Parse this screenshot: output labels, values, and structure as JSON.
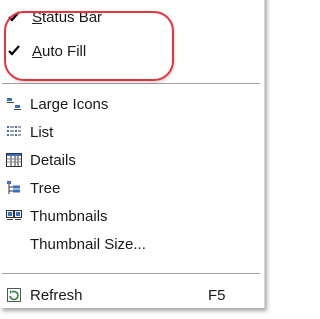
{
  "menu": {
    "items": [
      {
        "label_pre": "",
        "label_u": "S",
        "label_post": "tatus Bar",
        "checked": true
      },
      {
        "label_pre": "",
        "label_u": "A",
        "label_post": "uto Fill",
        "checked": true
      },
      {
        "label": "Large Icons",
        "icon": "large-icons-icon"
      },
      {
        "label": "List",
        "icon": "list-icon"
      },
      {
        "label": "Details",
        "icon": "details-icon"
      },
      {
        "label": "Tree",
        "icon": "tree-icon"
      },
      {
        "label": "Thumbnails",
        "icon": "thumbnails-icon"
      },
      {
        "label": "Thumbnail Size...",
        "icon": ""
      },
      {
        "label": "Refresh",
        "icon": "refresh-icon",
        "shortcut": "F5"
      }
    ]
  },
  "colors": {
    "highlight_oval": "#e8333c"
  }
}
